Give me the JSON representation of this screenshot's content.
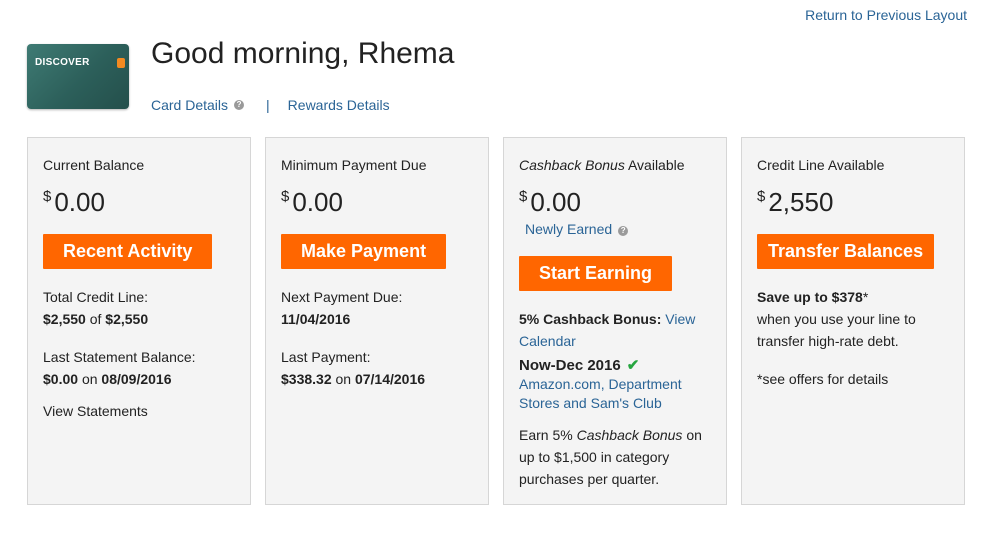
{
  "header": {
    "return_link": "Return to Previous Layout",
    "greeting": "Good morning, Rhema",
    "card_brand": "DISCOVER",
    "card_details": "Card Details",
    "separator": "|",
    "rewards_details": "Rewards Details",
    "info_glyph": "?"
  },
  "panels": {
    "balance": {
      "title": "Current Balance",
      "currency": "$",
      "amount": "0.00",
      "button": "Recent Activity",
      "credit_line_label": "Total Credit Line:",
      "credit_line_avail": "$2,550",
      "credit_line_of": "of",
      "credit_line_total": "$2,550",
      "statement_label": "Last Statement Balance:",
      "statement_amount": "$0.00",
      "statement_on": "on",
      "statement_date": "08/09/2016",
      "view_statements": "View Statements"
    },
    "payment": {
      "title": "Minimum Payment Due",
      "currency": "$",
      "amount": "0.00",
      "button": "Make Payment",
      "next_due_label": "Next Payment Due:",
      "next_due_date": "11/04/2016",
      "last_payment_label": "Last Payment:",
      "last_payment_amount": "$338.32",
      "last_payment_on": "on",
      "last_payment_date": "07/14/2016"
    },
    "cashback": {
      "title_italic": "Cashback Bonus",
      "title_rest": "Available",
      "currency": "$",
      "amount": "0.00",
      "newly_earned": "Newly Earned",
      "button": "Start Earning",
      "bonus_label": "5% Cashback Bonus:",
      "view_calendar_1": "View",
      "view_calendar_2": "Calendar",
      "period": "Now-Dec 2016",
      "check_glyph": "✔",
      "categories_1": "Amazon.com, Department",
      "categories_2": "Stores and Sam's Club",
      "earn_1a": "Earn 5%",
      "earn_1b": "Cashback Bonus",
      "earn_1c": "on",
      "earn_2": "up to $1,500 in category",
      "earn_3": "purchases per quarter."
    },
    "credit": {
      "title": "Credit Line Available",
      "currency": "$",
      "amount": "2,550",
      "button": "Transfer Balances",
      "save_bold": "Save up to $378",
      "save_star": "*",
      "save_2": "when you use your line to",
      "save_3": "transfer high-rate debt.",
      "offers_note": "*see offers for details"
    }
  },
  "colors": {
    "accent": "#ff6600",
    "link": "#2a6496",
    "panel_bg": "#f4f4f4",
    "check": "#26a640"
  }
}
